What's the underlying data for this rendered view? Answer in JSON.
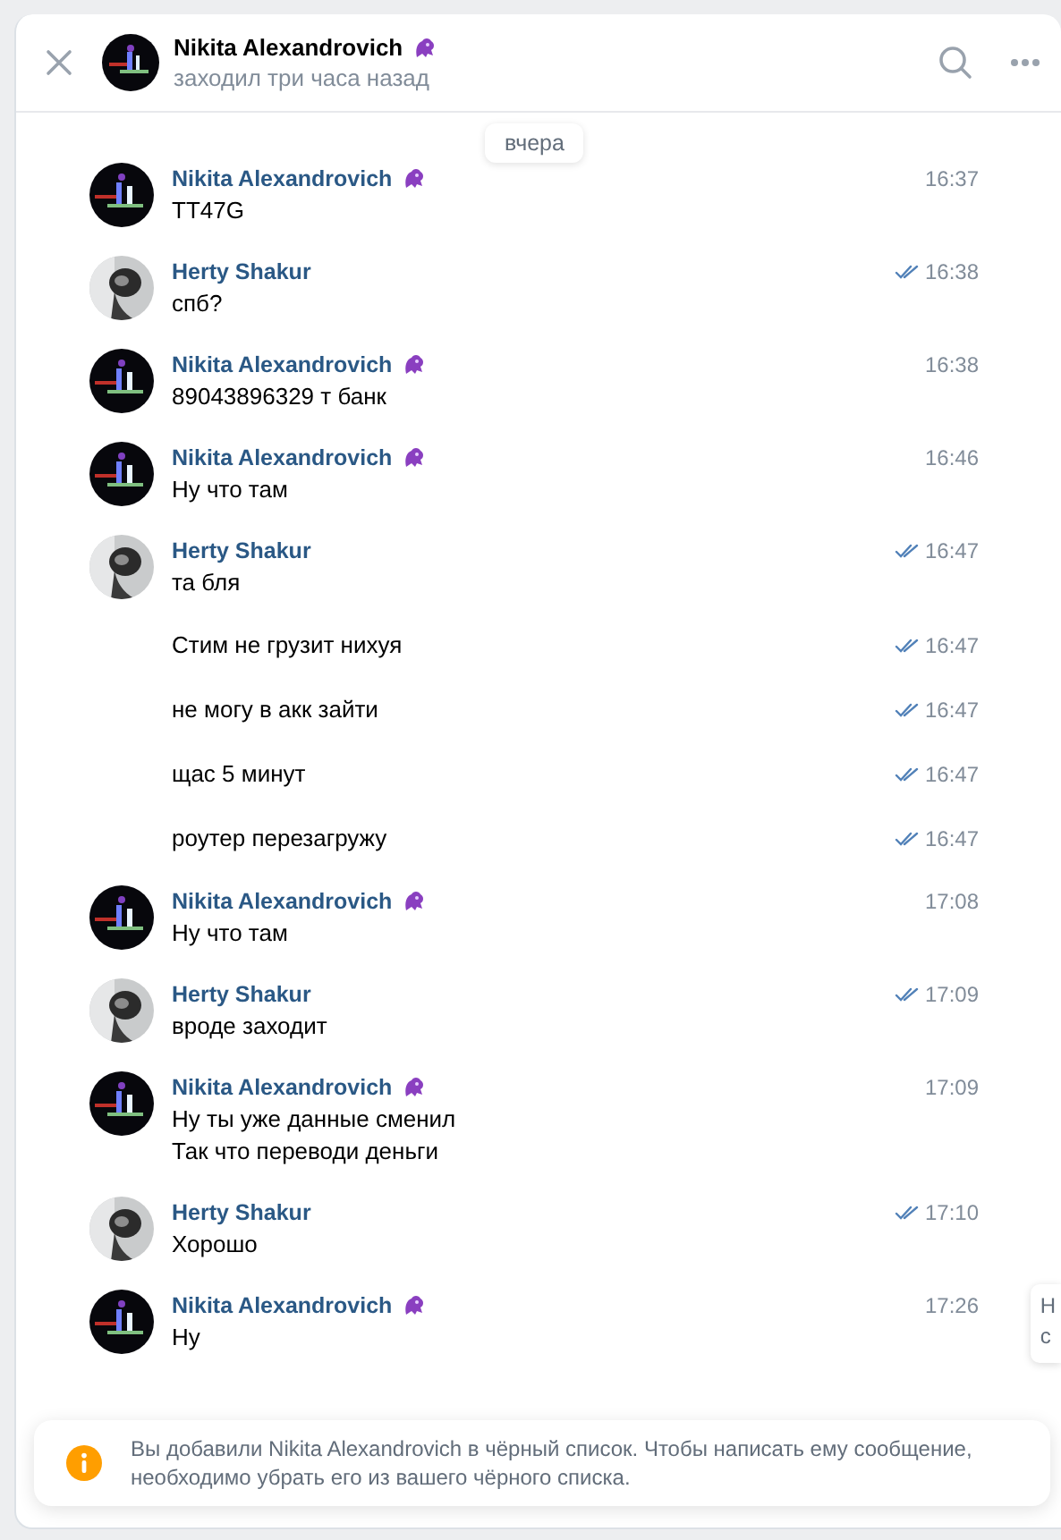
{
  "header": {
    "name": "Nikita Alexandrovich",
    "status": "заходил три часа назад"
  },
  "date_label": "вчера",
  "messages": [
    {
      "kind": "contact",
      "author": "Nikita Alexandrovich",
      "time": "16:37",
      "lines": [
        "TT47G"
      ]
    },
    {
      "kind": "self",
      "author": "Herty Shakur",
      "time": "16:38",
      "read": true,
      "lines": [
        "спб?"
      ]
    },
    {
      "kind": "contact",
      "author": "Nikita Alexandrovich",
      "time": "16:38",
      "lines": [
        "89043896329 т банк"
      ]
    },
    {
      "kind": "contact",
      "author": "Nikita Alexandrovich",
      "time": "16:46",
      "lines": [
        "Ну что там"
      ]
    },
    {
      "kind": "self",
      "author": "Herty Shakur",
      "time": "16:47",
      "read": true,
      "lines": [
        "та бля"
      ]
    },
    {
      "kind": "continuation",
      "time": "16:47",
      "read": true,
      "lines": [
        "Стим не грузит нихуя"
      ]
    },
    {
      "kind": "continuation",
      "time": "16:47",
      "read": true,
      "lines": [
        "не могу в акк зайти"
      ]
    },
    {
      "kind": "continuation",
      "time": "16:47",
      "read": true,
      "lines": [
        "щас 5 минут"
      ]
    },
    {
      "kind": "continuation",
      "time": "16:47",
      "read": true,
      "lines": [
        "роутер перезагружу"
      ]
    },
    {
      "kind": "contact",
      "author": "Nikita Alexandrovich",
      "time": "17:08",
      "lines": [
        "Ну что там"
      ]
    },
    {
      "kind": "self",
      "author": "Herty Shakur",
      "time": "17:09",
      "read": true,
      "lines": [
        "вроде заходит"
      ]
    },
    {
      "kind": "contact",
      "author": "Nikita Alexandrovich",
      "time": "17:09",
      "lines": [
        "Ну ты уже данные сменил",
        "Так что переводи деньги"
      ]
    },
    {
      "kind": "self",
      "author": "Herty Shakur",
      "time": "17:10",
      "read": true,
      "lines": [
        "Хорошо"
      ]
    },
    {
      "kind": "contact",
      "author": "Nikita Alexandrovich",
      "time": "17:26",
      "lines": [
        "Ну"
      ]
    }
  ],
  "side_popup": {
    "lines": [
      "Н",
      "с"
    ]
  },
  "notice": {
    "text": "Вы добавили Nikita Alexandrovich в чёрный список. Чтобы написать ему сообщение, необходимо убрать его из вашего чёрного списка."
  }
}
